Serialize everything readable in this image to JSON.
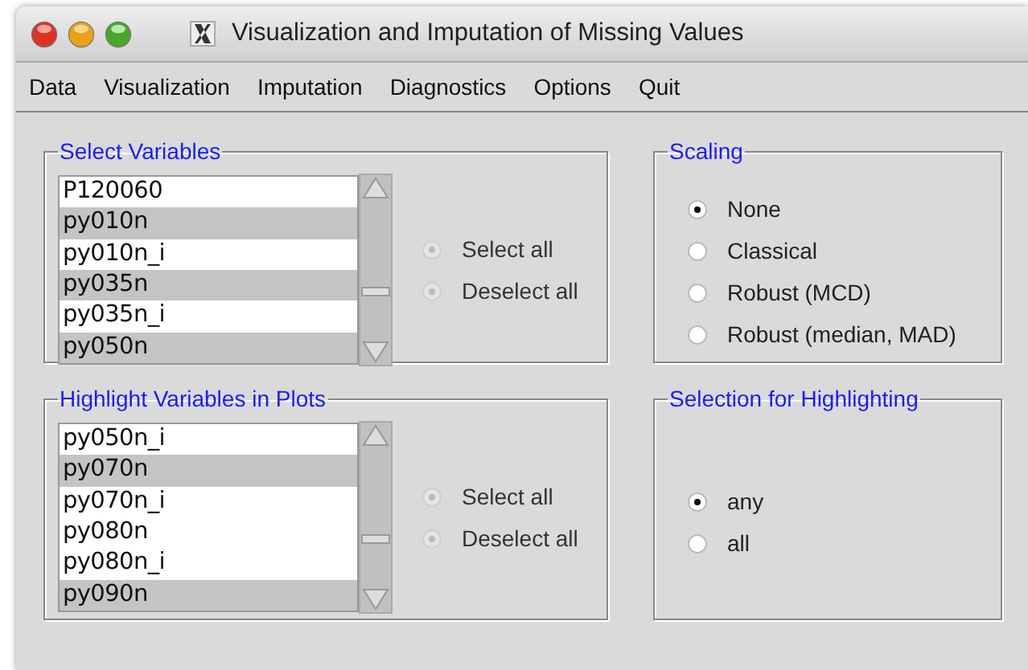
{
  "window": {
    "title": "Visualization and Imputation of Missing Values"
  },
  "menu": [
    "Data",
    "Visualization",
    "Imputation",
    "Diagnostics",
    "Options",
    "Quit"
  ],
  "panels": [
    {
      "kind": "list",
      "title": "Select Variables",
      "items": [
        {
          "label": "P120060",
          "selected": false
        },
        {
          "label": "py010n",
          "selected": true
        },
        {
          "label": "py010n_i",
          "selected": false
        },
        {
          "label": "py035n",
          "selected": true
        },
        {
          "label": "py035n_i",
          "selected": false
        },
        {
          "label": "py050n",
          "selected": true
        }
      ],
      "options": [
        {
          "label": "Select all",
          "disabled": true,
          "selected": false
        },
        {
          "label": "Deselect all",
          "disabled": true,
          "selected": false
        }
      ]
    },
    {
      "kind": "radio",
      "title": "Scaling",
      "options": [
        {
          "label": "None",
          "disabled": false,
          "selected": true
        },
        {
          "label": "Classical",
          "disabled": false,
          "selected": false
        },
        {
          "label": "Robust (MCD)",
          "disabled": false,
          "selected": false
        },
        {
          "label": "Robust (median, MAD)",
          "disabled": false,
          "selected": false
        }
      ]
    },
    {
      "kind": "list",
      "title": "Highlight Variables in Plots",
      "items": [
        {
          "label": "py050n_i",
          "selected": false
        },
        {
          "label": "py070n",
          "selected": true
        },
        {
          "label": "py070n_i",
          "selected": false
        },
        {
          "label": "py080n",
          "selected": false
        },
        {
          "label": "py080n_i",
          "selected": false
        },
        {
          "label": "py090n",
          "selected": true
        }
      ],
      "options": [
        {
          "label": "Select all",
          "disabled": true,
          "selected": false
        },
        {
          "label": "Deselect all",
          "disabled": true,
          "selected": false
        }
      ]
    },
    {
      "kind": "radio",
      "title": "Selection for Highlighting",
      "options": [
        {
          "label": "any",
          "disabled": false,
          "selected": true
        },
        {
          "label": "all",
          "disabled": false,
          "selected": false
        }
      ]
    }
  ]
}
